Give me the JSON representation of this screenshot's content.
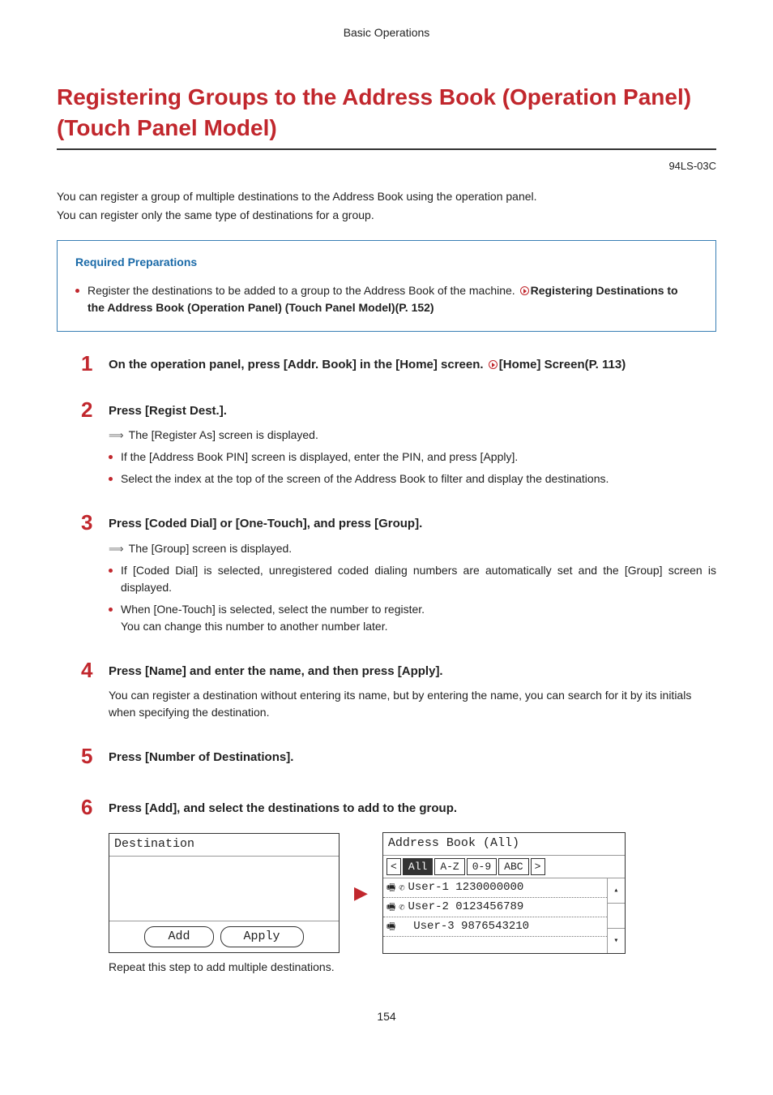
{
  "header": "Basic Operations",
  "title": "Registering Groups to the Address Book (Operation Panel) (Touch Panel Model)",
  "doc_code": "94LS-03C",
  "intro": {
    "line1": "You can register a group of multiple destinations to the Address Book using the operation panel.",
    "line2": "You can register only the same type of destinations for a group."
  },
  "required": {
    "title": "Required Preparations",
    "bullet_text": "Register the destinations to be added to a group to the Address Book of the machine. ",
    "link": "Registering Destinations to the Address Book (Operation Panel) (Touch Panel Model)(P. 152)"
  },
  "steps": {
    "s1": {
      "num": "1",
      "title_a": "On the operation panel, press [Addr. Book] in the [Home] screen. ",
      "title_b": "[Home] Screen(P. 113)"
    },
    "s2": {
      "num": "2",
      "title": "Press [Regist Dest.].",
      "n1": "The [Register As] screen is displayed.",
      "n2": "If the [Address Book PIN] screen is displayed, enter the PIN, and press [Apply].",
      "n3": "Select the index at the top of the screen of the Address Book to filter and display the destinations."
    },
    "s3": {
      "num": "3",
      "title": "Press [Coded Dial] or [One-Touch], and press [Group].",
      "n1": "The [Group] screen is displayed.",
      "n2": "If [Coded Dial] is selected, unregistered coded dialing numbers are automatically set and the [Group] screen is displayed.",
      "n3a": "When [One-Touch] is selected, select the number to register.",
      "n3b": "You can change this number to another number later."
    },
    "s4": {
      "num": "4",
      "title": "Press [Name] and enter the name, and then press [Apply].",
      "n1": "You can register a destination without entering its name, but by entering the name, you can search for it by its initials when specifying the destination."
    },
    "s5": {
      "num": "5",
      "title": "Press [Number of Destinations]."
    },
    "s6": {
      "num": "6",
      "title": "Press [Add], and select the destinations to add to the group.",
      "left_title": "Destination",
      "btn_add": "Add",
      "btn_apply": "Apply",
      "right_title": "Address Book (All)",
      "tabs": {
        "all": "All",
        "az": "A-Z",
        "n09": "0-9",
        "abc": "ABC"
      },
      "rows": {
        "r1": "User-1 1230000000",
        "r2": "User-2 0123456789",
        "r3": "User-3 9876543210"
      },
      "caption": "Repeat this step to add multiple destinations."
    }
  },
  "page_number": "154"
}
